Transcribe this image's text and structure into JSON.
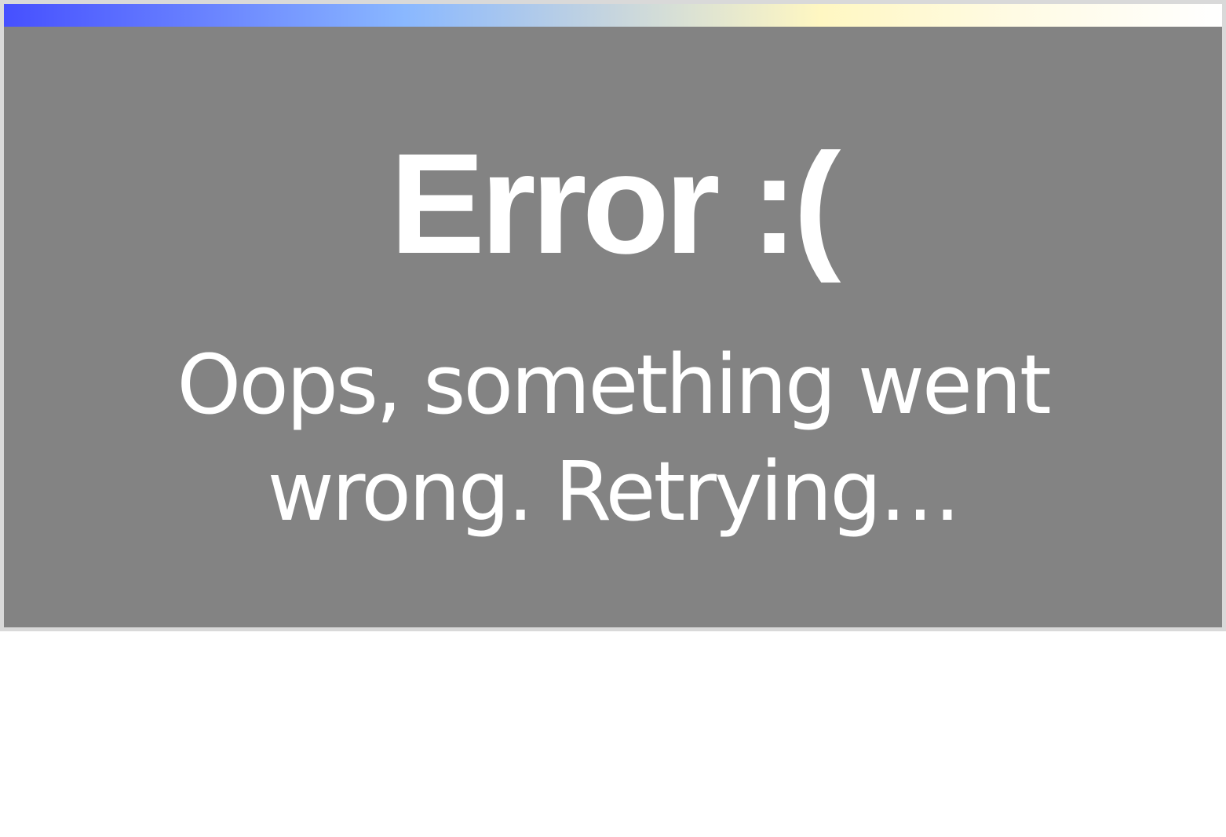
{
  "progress": {
    "fraction": 1.0,
    "gradient_colors": [
      "#4650ff",
      "#6a84ff",
      "#8ab8ff",
      "#c6d5de",
      "#fff7c2",
      "#fffbe4",
      "#ffffff"
    ]
  },
  "colors": {
    "panel_background": "#838383",
    "panel_border": "#d9d9d9",
    "text": "#ffffff"
  },
  "error": {
    "title": "Error :(",
    "message": "Oops, something went wrong. Retrying…"
  }
}
